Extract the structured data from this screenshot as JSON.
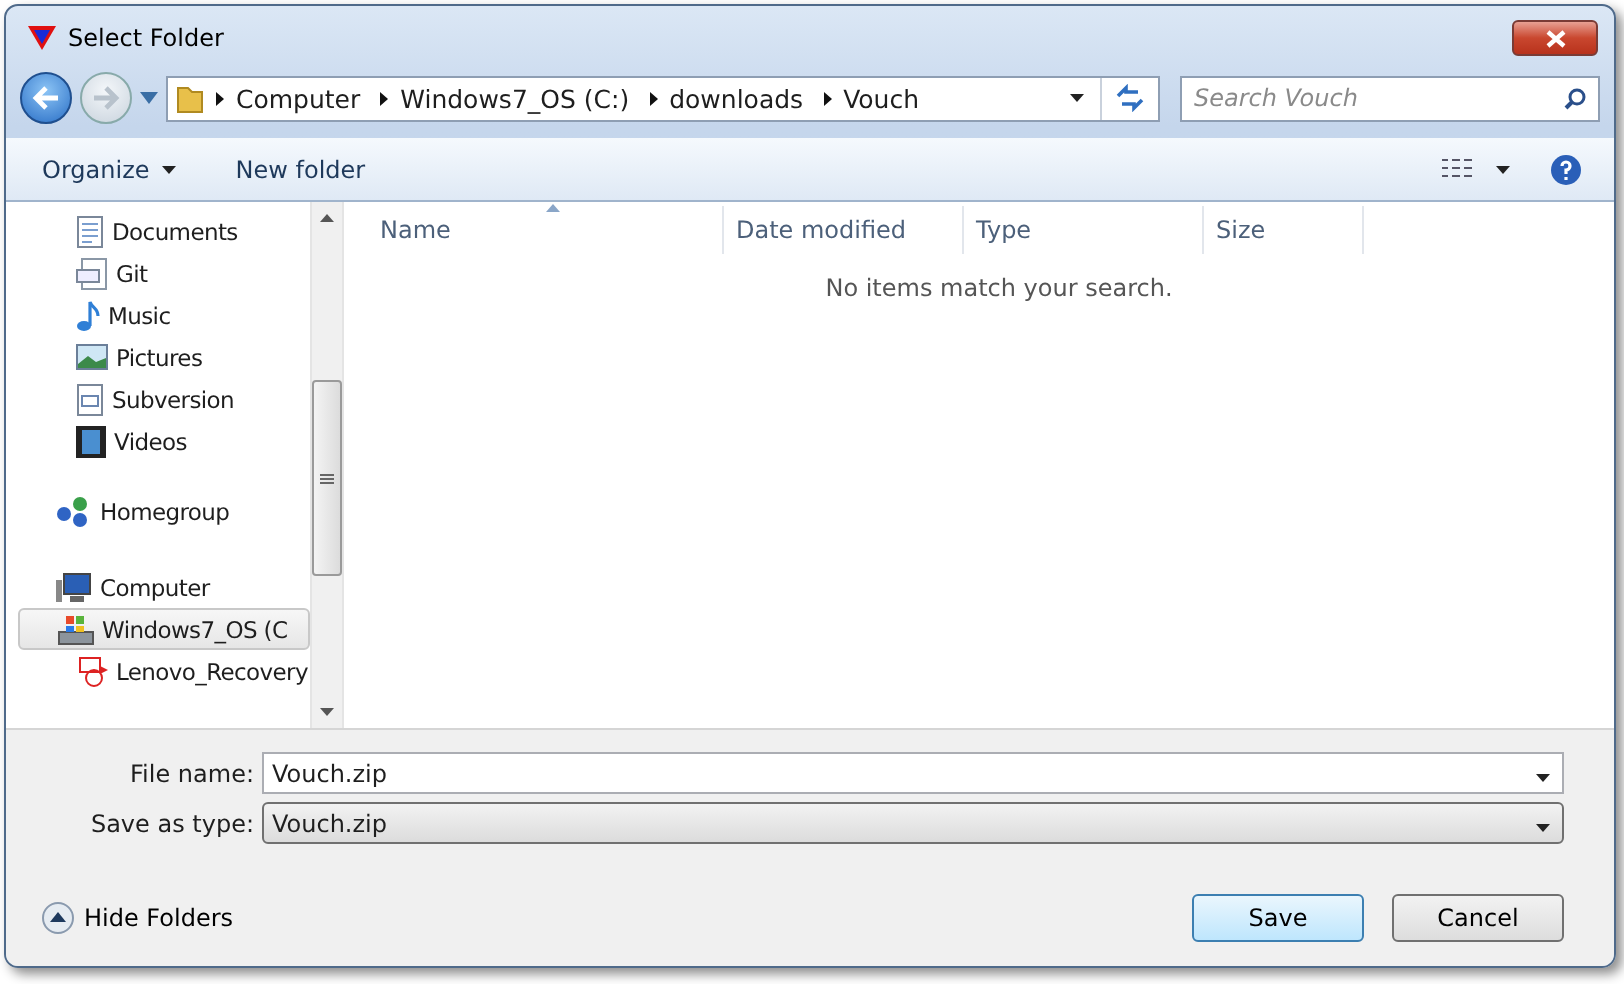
{
  "window": {
    "title": "Select Folder"
  },
  "address": {
    "crumbs": [
      "Computer",
      "Windows7_OS (C:)",
      "downloads",
      "Vouch"
    ]
  },
  "search": {
    "placeholder": "Search Vouch"
  },
  "toolbar": {
    "organize": "Organize",
    "new_folder": "New folder"
  },
  "sidebar": {
    "library_items": [
      {
        "label": "Documents",
        "kind": "documents",
        "selected": false
      },
      {
        "label": "Git",
        "kind": "git",
        "selected": false
      },
      {
        "label": "Music",
        "kind": "music",
        "selected": false
      },
      {
        "label": "Pictures",
        "kind": "pictures",
        "selected": false
      },
      {
        "label": "Subversion",
        "kind": "subversion",
        "selected": false
      },
      {
        "label": "Videos",
        "kind": "videos",
        "selected": false
      }
    ],
    "groups": [
      {
        "label": "Homegroup",
        "kind": "homegroup",
        "selected": false
      },
      {
        "label": "Computer",
        "kind": "computer",
        "selected": false,
        "children": [
          {
            "label": "Windows7_OS (C",
            "kind": "drive",
            "selected": true
          },
          {
            "label": "Lenovo_Recovery",
            "kind": "recovery",
            "selected": false
          }
        ]
      }
    ]
  },
  "table": {
    "columns": [
      {
        "label": "Name",
        "sorted": true
      },
      {
        "label": "Date modified",
        "sorted": false
      },
      {
        "label": "Type",
        "sorted": false
      },
      {
        "label": "Size",
        "sorted": false
      }
    ],
    "empty_message": "No items match your search."
  },
  "form": {
    "file_name_label": "File name:",
    "file_name": "Vouch.zip",
    "type_label": "Save as type:",
    "type": "Vouch.zip"
  },
  "footer": {
    "hide_folders": "Hide Folders",
    "save": "Save",
    "cancel": "Cancel"
  }
}
